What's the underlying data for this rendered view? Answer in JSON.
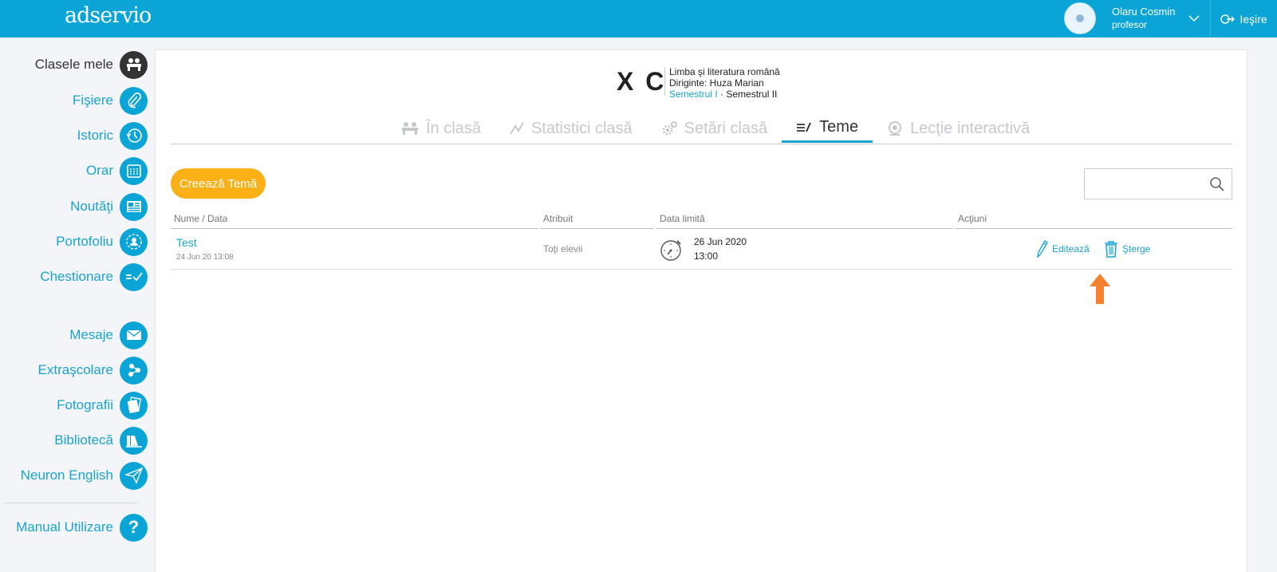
{
  "header": {
    "logo": "adservio",
    "user_name": "Olaru Cosmin",
    "user_role": "profesor",
    "logout_label": "Ieşire",
    "color": "#0aa5d6"
  },
  "sidebar": {
    "items": [
      {
        "label": "Clasele mele",
        "icon": "class-icon",
        "active": true
      },
      {
        "label": "Fişiere",
        "icon": "paperclip-icon"
      },
      {
        "label": "Istoric",
        "icon": "history-icon"
      },
      {
        "label": "Orar",
        "icon": "calendar-icon"
      },
      {
        "label": "Noutăţi",
        "icon": "news-icon"
      },
      {
        "label": "Portofoliu",
        "icon": "portfolio-icon"
      },
      {
        "label": "Chestionare",
        "icon": "questionnaire-icon"
      },
      {
        "label": "Mesaje",
        "icon": "envelope-icon"
      },
      {
        "label": "Extraşcolare",
        "icon": "extracurricular-icon"
      },
      {
        "label": "Fotografii",
        "icon": "photos-icon"
      },
      {
        "label": "Bibliotecă",
        "icon": "library-icon"
      },
      {
        "label": "Neuron English",
        "icon": "paper-plane-icon"
      },
      {
        "label": "Manual Utilizare",
        "icon": "question-icon"
      }
    ]
  },
  "class_header": {
    "name": "X C",
    "subject": "Limba şi literatura română",
    "diriginte": "Diriginte: Huza Marian",
    "semester_active": "Semestrul I",
    "semester_sep": " · ",
    "semester_other": "Semestrul II"
  },
  "tabs": [
    {
      "label": "În clasă",
      "icon": "people-icon"
    },
    {
      "label": "Statistici clasă",
      "icon": "chart-icon"
    },
    {
      "label": "Setări clasă",
      "icon": "gears-icon"
    },
    {
      "label": "Teme",
      "icon": "homework-icon",
      "active": true
    },
    {
      "label": "Lecţie interactivă",
      "icon": "webcam-icon"
    }
  ],
  "toolbar": {
    "create_label": "Creează Temă",
    "search_placeholder": ""
  },
  "table": {
    "columns": [
      "Nume / Data",
      "Atribuit",
      "Data limită",
      "Acţiuni"
    ],
    "rows": [
      {
        "title": "Test",
        "created": "24 Jun 20 13:08",
        "assigned": "Toţi elevii",
        "deadline_date": "26 Jun 2020",
        "deadline_time": "13:00",
        "edit_label": "Editează",
        "delete_label": "Şterge"
      }
    ]
  },
  "colors": {
    "accent": "#1ba3cf",
    "create_button": "#fbb116",
    "annotation_arrow": "#f7812f"
  }
}
